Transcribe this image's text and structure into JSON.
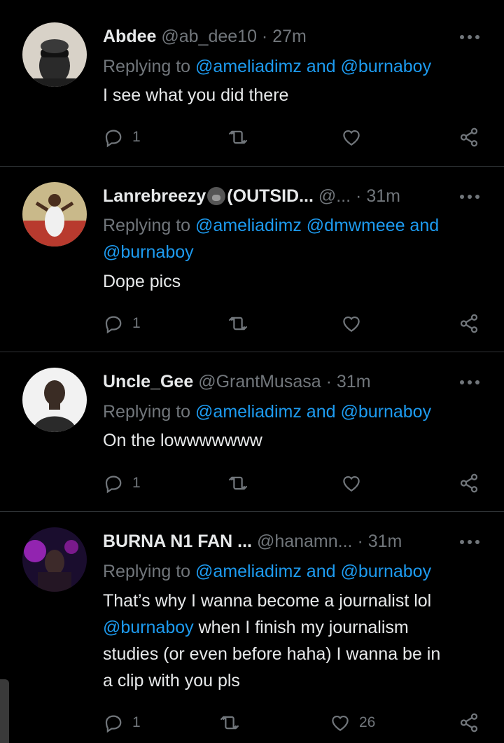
{
  "tweets": [
    {
      "name": "Abdee",
      "handle": "@ab_dee10",
      "time": "27m",
      "replying_prefix": "Replying to",
      "replying_to": "@ameliadimz and @burnaboy",
      "replying_to_line2": "",
      "body": [
        {
          "text": "I see what you did there",
          "mention": false
        }
      ],
      "replies": "1",
      "retweets": "",
      "likes": "",
      "avatar_colors": [
        "#d8d2c8",
        "#3a3a3a"
      ]
    },
    {
      "name": "Lanrebreezy",
      "name_suffix": "(OUTSID...",
      "handle": "@...",
      "time": "31m",
      "replying_prefix": "Replying to",
      "replying_to": "@ameliadimz @dmwmeee and",
      "replying_to_line2": "@burnaboy",
      "body": [
        {
          "text": "Dope pics",
          "mention": false
        }
      ],
      "replies": "1",
      "retweets": "",
      "likes": "",
      "avatar_colors": [
        "#c9a35a",
        "#b83a2e"
      ]
    },
    {
      "name": "Uncle_Gee",
      "handle": "@GrantMusasa",
      "time": "31m",
      "replying_prefix": "Replying to",
      "replying_to": "@ameliadimz and @burnaboy",
      "replying_to_line2": "",
      "body": [
        {
          "text": "On the lowwwwwww",
          "mention": false
        }
      ],
      "replies": "1",
      "retweets": "",
      "likes": "",
      "avatar_colors": [
        "#f2f2f2",
        "#3a2c24"
      ]
    },
    {
      "name": "BURNA N1 FAN ...",
      "handle": "@hanamn...",
      "time": "31m",
      "replying_prefix": "Replying to",
      "replying_to": "@ameliadimz and @burnaboy",
      "replying_to_line2": "",
      "body_lines": [
        "That’s why I wanna become a journalist lol",
        "@burnaboy",
        "when I finish my journalism",
        "studies (or even before haha) I wanna be in",
        "a clip with you pls"
      ],
      "replies": "1",
      "retweets": "",
      "likes": "26",
      "avatar_colors": [
        "#7a1a8c",
        "#1a0d2e"
      ]
    }
  ],
  "icons": {
    "reply": "reply-icon",
    "retweet": "retweet-icon",
    "like": "heart-icon",
    "share": "share-icon",
    "more": "more-icon"
  },
  "colors": {
    "background": "#000000",
    "text": "#e7e9ea",
    "secondary": "#71767b",
    "link": "#1d9bf0",
    "divider": "#2f3336"
  }
}
